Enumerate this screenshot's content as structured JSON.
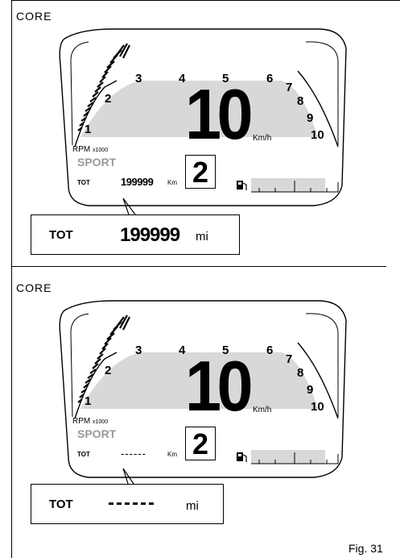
{
  "figure_label": "Fig. 31",
  "panels": [
    {
      "mode_label": "CORE",
      "speed": "10",
      "speed_unit": "Km/h",
      "rpm_label": "RPM",
      "rpm_multiplier": "x1000",
      "rpm_scale": [
        "1",
        "2",
        "3",
        "4",
        "5",
        "6",
        "7",
        "8",
        "9",
        "10"
      ],
      "riding_mode": "SPORT",
      "tot_label": "TOT",
      "odometer_value": "199999",
      "odometer_unit": "Km",
      "gear": "2",
      "callout": {
        "label": "TOT",
        "value": "199999",
        "unit": "mi"
      }
    },
    {
      "mode_label": "CORE",
      "speed": "10",
      "speed_unit": "Km/h",
      "rpm_label": "RPM",
      "rpm_multiplier": "x1000",
      "rpm_scale": [
        "1",
        "2",
        "3",
        "4",
        "5",
        "6",
        "7",
        "8",
        "9",
        "10"
      ],
      "riding_mode": "SPORT",
      "tot_label": "TOT",
      "odometer_value": "------",
      "odometer_unit": "Km",
      "gear": "2",
      "callout": {
        "label": "TOT",
        "value": "------",
        "unit": "mi"
      }
    }
  ]
}
